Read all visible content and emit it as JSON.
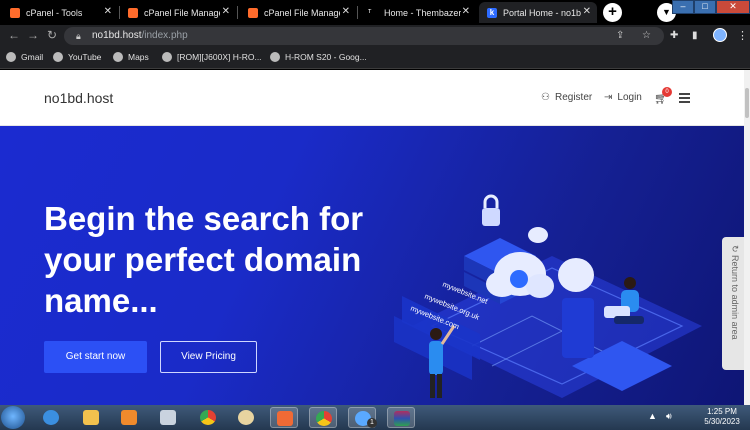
{
  "browser": {
    "tabs": [
      {
        "title": "cPanel - Tools",
        "favicon": "cpanel-icon",
        "active": false
      },
      {
        "title": "cPanel File Manager",
        "favicon": "cpanel-icon",
        "active": false
      },
      {
        "title": "cPanel File Manager",
        "favicon": "cpanel-icon",
        "active": false
      },
      {
        "title": "Home - Thembazer",
        "favicon": "site-icon",
        "active": false
      },
      {
        "title": "Portal Home - no1b",
        "favicon": "k-icon",
        "active": true
      }
    ],
    "url_host": "no1bd.host",
    "url_path": "/index.php",
    "bookmarks": [
      "Gmail",
      "YouTube",
      "Maps",
      "[ROM][J600X] H-RO...",
      "H-ROM S20 - Goog..."
    ]
  },
  "site": {
    "logo": "no1bd.host",
    "nav": {
      "register": "Register",
      "login": "Login",
      "cart_count": "0"
    },
    "hero": {
      "title": "Begin the search for your perfect domain name...",
      "primary_button": "Get start now",
      "secondary_button": "View Pricing",
      "illustration_labels": [
        "mywebsite.net",
        "mywebsite.org.uk",
        "mywebsite.com"
      ]
    },
    "admin_tab": "Return to admin area"
  },
  "taskbar": {
    "time": "1:25 PM",
    "date": "5/30/2023",
    "chrome_badge": "1"
  },
  "colors": {
    "hero_blue": "#1b2bd0",
    "primary_button": "#2c50f5",
    "cart_badge": "#e53935"
  }
}
